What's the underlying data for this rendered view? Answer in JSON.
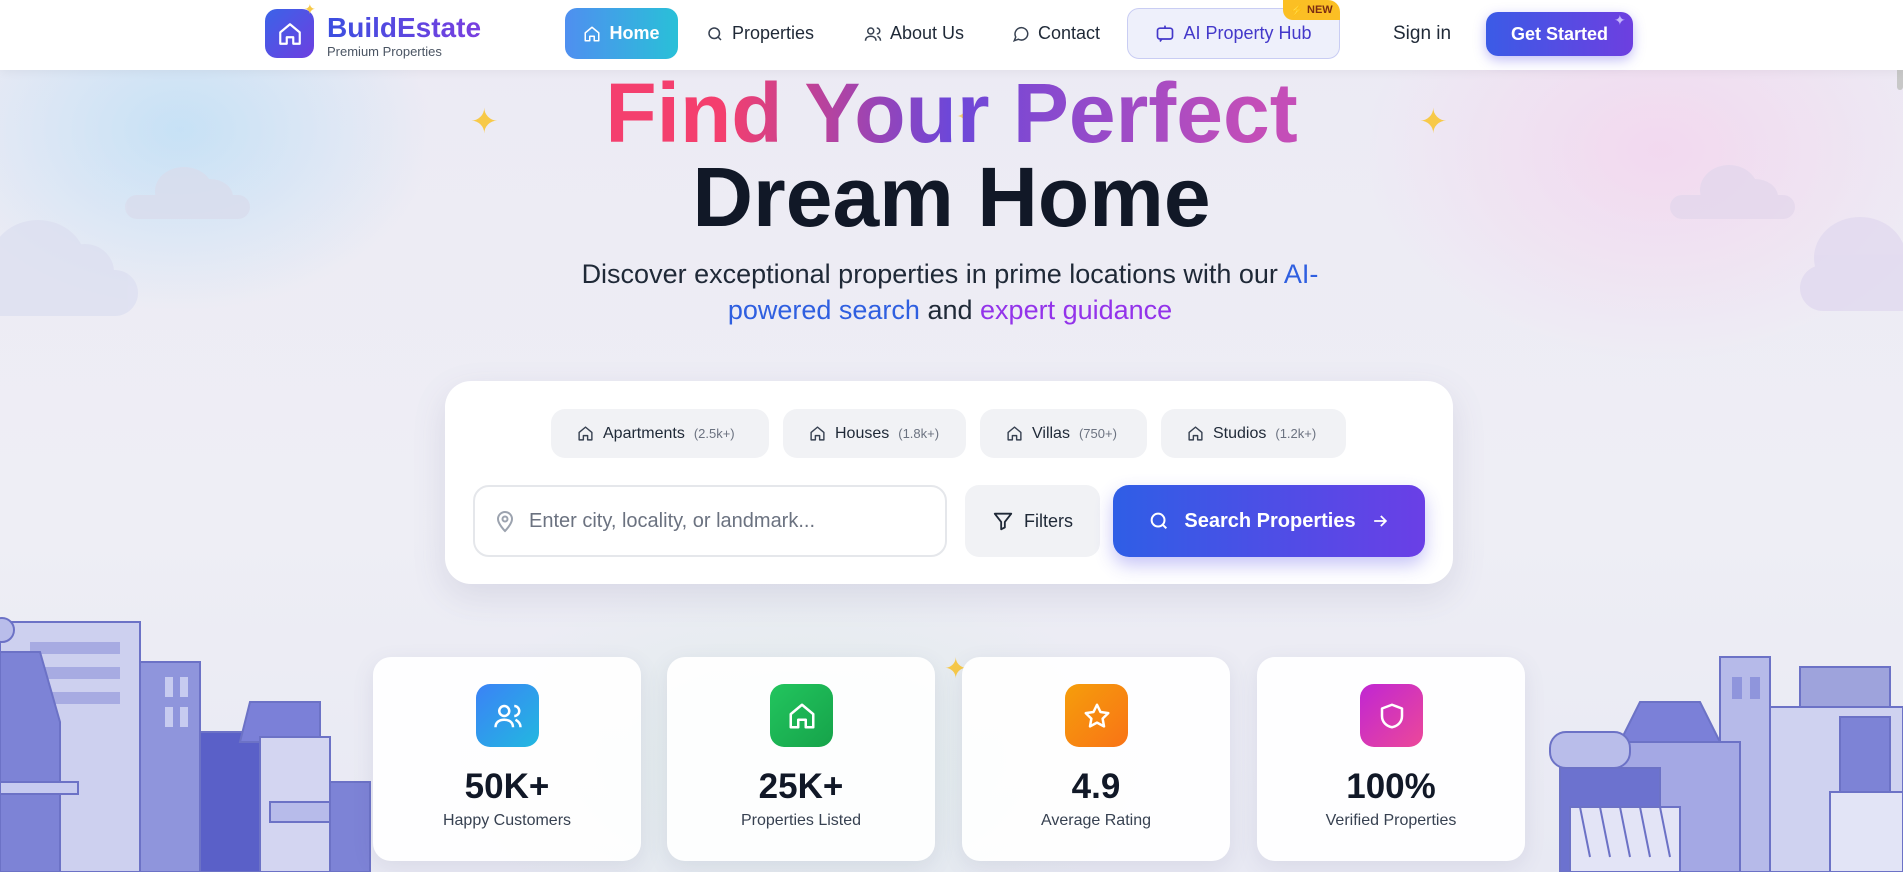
{
  "brand": {
    "name": "BuildEstate",
    "tagline": "Premium Properties"
  },
  "nav": {
    "items": [
      {
        "label": "Home",
        "icon": "home-icon"
      },
      {
        "label": "Properties",
        "icon": "search-icon"
      },
      {
        "label": "About Us",
        "icon": "users-icon"
      },
      {
        "label": "Contact",
        "icon": "chat-bubble-icon"
      }
    ],
    "ai_hub": {
      "label": "AI Property Hub",
      "badge": "NEW",
      "icon": "bot-chat-icon"
    },
    "sign_in": "Sign in",
    "get_started": "Get Started"
  },
  "hero": {
    "title_line1": "Find Your Perfect",
    "title_line2": "Dream Home",
    "subtitle_start": "Discover exceptional properties in prime locations with our",
    "subtitle_highlight1": "AI-powered search",
    "subtitle_mid": "and",
    "subtitle_highlight2": "expert guidance"
  },
  "search": {
    "categories": [
      {
        "label": "Apartments",
        "count": "(2.5k+)"
      },
      {
        "label": "Houses",
        "count": "(1.8k+)"
      },
      {
        "label": "Villas",
        "count": "(750+)"
      },
      {
        "label": "Studios",
        "count": "(1.2k+)"
      }
    ],
    "placeholder": "Enter city, locality, or landmark...",
    "filters_label": "Filters",
    "button_label": "Search Properties"
  },
  "stats": [
    {
      "value": "50K+",
      "label": "Happy Customers",
      "icon": "users-icon",
      "color": "#3b82f6"
    },
    {
      "value": "25K+",
      "label": "Properties Listed",
      "icon": "home-icon",
      "color": "#22c55e"
    },
    {
      "value": "4.9",
      "label": "Average Rating",
      "icon": "star-icon",
      "color": "#f59e0b"
    },
    {
      "value": "100%",
      "label": "Verified Properties",
      "icon": "shield-icon",
      "color": "#d946ef"
    }
  ],
  "colors": {
    "accent_blue": "#3b5be6",
    "accent_purple": "#6d3fe0",
    "title_pink": "#f43f6e"
  }
}
